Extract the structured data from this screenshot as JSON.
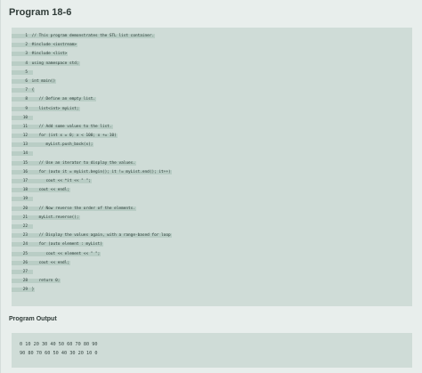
{
  "title": "Program 18-6",
  "code_lines": [
    {
      "num": "1",
      "text": "// This program demonstrates the STL list container."
    },
    {
      "num": "2",
      "text": "#include <iostream>"
    },
    {
      "num": "3",
      "text": "#include <list>"
    },
    {
      "num": "4",
      "text": "using namespace std;"
    },
    {
      "num": "5",
      "text": ""
    },
    {
      "num": "6",
      "text": "int main()"
    },
    {
      "num": "7",
      "text": "{"
    },
    {
      "num": "8",
      "text": "   // Define an empty list."
    },
    {
      "num": "9",
      "text": "   list<int> myList;"
    },
    {
      "num": "10",
      "text": ""
    },
    {
      "num": "11",
      "text": "   // Add some values to the list."
    },
    {
      "num": "12",
      "text": "   for (int x = 0; x < 100; x += 10)"
    },
    {
      "num": "13",
      "text": "      myList.push_back(x);"
    },
    {
      "num": "14",
      "text": ""
    },
    {
      "num": "15",
      "text": "   // Use an iterator to display the values."
    },
    {
      "num": "16",
      "text": "   for (auto it = myList.begin(); it != myList.end(); it++)"
    },
    {
      "num": "17",
      "text": "      cout << *it << \" \";"
    },
    {
      "num": "18",
      "text": "   cout << endl;"
    },
    {
      "num": "19",
      "text": ""
    },
    {
      "num": "20",
      "text": "   // Now reverse the order of the elements."
    },
    {
      "num": "21",
      "text": "   myList.reverse();"
    },
    {
      "num": "22",
      "text": ""
    },
    {
      "num": "23",
      "text": "   // Display the values again, with a range-based for loop"
    },
    {
      "num": "24",
      "text": "   for (auto element : myList)"
    },
    {
      "num": "25",
      "text": "      cout << element << \" \";"
    },
    {
      "num": "26",
      "text": "   cout << endl;"
    },
    {
      "num": "27",
      "text": ""
    },
    {
      "num": "28",
      "text": "   return 0;"
    },
    {
      "num": "29",
      "text": "}"
    }
  ],
  "output_title": "Program Output",
  "output_lines": [
    "0 10 20 30 40 50 60 70 80 90",
    "90 80 70 60 50 40 30 20 10 0"
  ]
}
